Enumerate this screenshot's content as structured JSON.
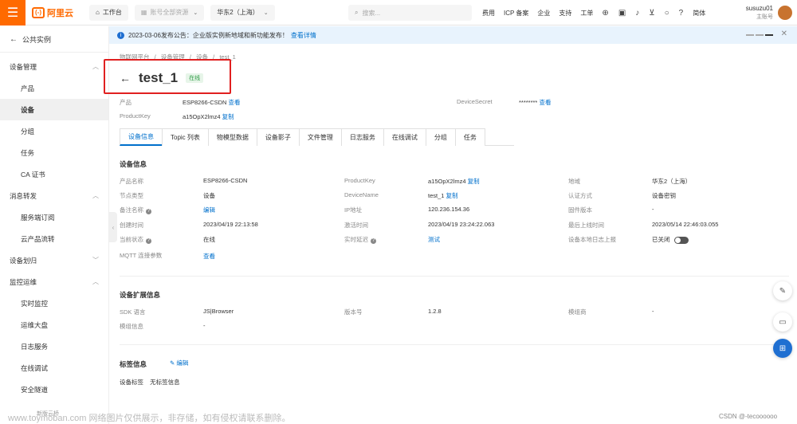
{
  "topbar": {
    "logo_mark": "(-)",
    "logo_text": "阿里云",
    "workbench": "工作台",
    "account_resources": "账号全部资源",
    "region": "华东2（上海）",
    "search_placeholder": "搜索...",
    "links": [
      "费用",
      "ICP 备案",
      "企业",
      "支持",
      "工单"
    ],
    "lang": "简体",
    "username": "susuzu01",
    "role": "主账号"
  },
  "sidebar": {
    "back_label": "公共实例",
    "groups": [
      {
        "label": "设备管理",
        "items": [
          "产品",
          "设备",
          "分组",
          "任务",
          "CA 证书"
        ]
      },
      {
        "label": "消息转发",
        "items": [
          "服务端订阅",
          "云产品流转"
        ]
      },
      {
        "label": "设备划归",
        "items": []
      },
      {
        "label": "监控运维",
        "items": [
          "实时监控",
          "运维大盘",
          "日志服务",
          "在线调试",
          "安全隧道"
        ]
      }
    ],
    "active_item": "设备",
    "footer": "新版云桥"
  },
  "notice": {
    "text": "2023-03-06发布公告：企业版实例新地域和新功能发布！",
    "link": "查看详情"
  },
  "breadcrumb": [
    "物联网平台",
    "/",
    "设备管理",
    "/",
    "设备",
    "/",
    "test_1"
  ],
  "device": {
    "name": "test_1",
    "status": "在线",
    "product_label": "产品",
    "product_value": "ESP8266-CSDN",
    "product_link": "查看",
    "productkey_label": "ProductKey",
    "productkey_value": "a15OpX2lmz4",
    "productkey_link": "复制",
    "secret_label": "DeviceSecret",
    "secret_value": "********",
    "secret_link": "查看"
  },
  "tabs": [
    "设备信息",
    "Topic 列表",
    "物模型数据",
    "设备影子",
    "文件管理",
    "日志服务",
    "在线调试",
    "分组",
    "任务"
  ],
  "device_info": {
    "title": "设备信息",
    "rows": [
      [
        [
          "产品名称",
          "ESP8266-CSDN"
        ],
        [
          "ProductKey",
          "a15OpX2lmz4"
        ],
        [
          "地域",
          "华东2（上海）"
        ]
      ],
      [
        [
          "节点类型",
          "设备"
        ],
        [
          "DeviceName",
          "test_1"
        ],
        [
          "认证方式",
          "设备密钥"
        ]
      ],
      [
        [
          "备注名称",
          "编辑"
        ],
        [
          "IP地址",
          "120.236.154.36"
        ],
        [
          "固件版本",
          "-"
        ]
      ],
      [
        [
          "创建时间",
          "2023/04/19 22:13:58"
        ],
        [
          "激活时间",
          "2023/04/19 23:24:22.063"
        ],
        [
          "最后上线时间",
          "2023/05/14 22:46:03.055"
        ]
      ],
      [
        [
          "当前状态",
          "在线"
        ],
        [
          "实时延迟",
          "测试"
        ],
        [
          "设备本地日志上报",
          "已关闭"
        ]
      ],
      [
        [
          "MQTT 连接参数",
          "查看"
        ]
      ]
    ],
    "copy_link": "复制"
  },
  "ext_info": {
    "title": "设备扩展信息",
    "rows": [
      [
        [
          "SDK 语言",
          "JS|Browser"
        ],
        [
          "版本号",
          "1.2.8"
        ],
        [
          "模组商",
          "-"
        ]
      ],
      [
        [
          "模组信息",
          "-"
        ]
      ]
    ]
  },
  "tags": {
    "title": "标签信息",
    "edit": "编辑",
    "label": "设备标签",
    "value": "无标签信息"
  },
  "watermark": "www.toymoban.com 网络图片仅供展示，非存储，如有侵权请联系删除。",
  "csdn": "CSDN @-tecoooooo",
  "colors": {
    "brand": "#ff6a00",
    "link": "#0070cc",
    "online": "#2e9b45"
  }
}
